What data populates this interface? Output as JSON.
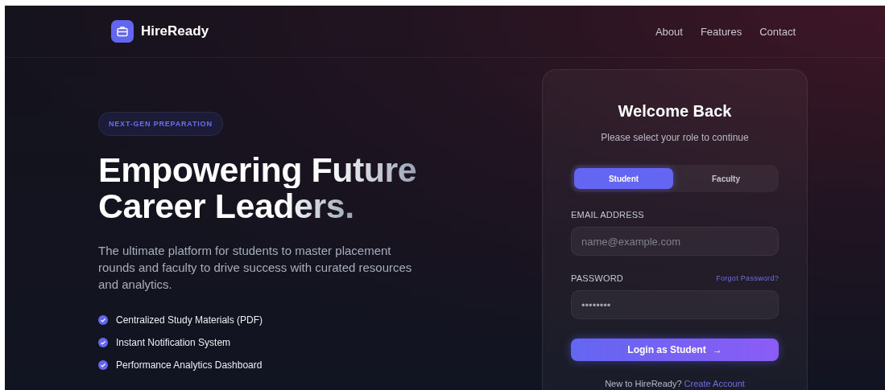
{
  "nav": {
    "brand": "HireReady",
    "links": [
      "About",
      "Features",
      "Contact"
    ]
  },
  "hero": {
    "badge": "NEXT-GEN PREPARATION",
    "title_lines": [
      "Empowering Future",
      "Career Leaders."
    ],
    "description": "The ultimate platform for students to master placement rounds and faculty to drive success with curated resources and analytics.",
    "features": [
      "Centralized Study Materials (PDF)",
      "Instant Notification System",
      "Performance Analytics Dashboard"
    ]
  },
  "login": {
    "title": "Welcome Back",
    "subtitle": "Please select your role to continue",
    "roles": [
      {
        "label": "Student",
        "selected": true
      },
      {
        "label": "Faculty",
        "selected": false
      }
    ],
    "email": {
      "label": "EMAIL ADDRESS",
      "placeholder": "name@example.com"
    },
    "password": {
      "label": "PASSWORD",
      "link": "Forgot Password?",
      "value": "••••••••"
    },
    "submit": "Login as Student",
    "submit_arrow": "→",
    "footer": {
      "text": "New to HireReady?",
      "link": "Create Account"
    }
  }
}
